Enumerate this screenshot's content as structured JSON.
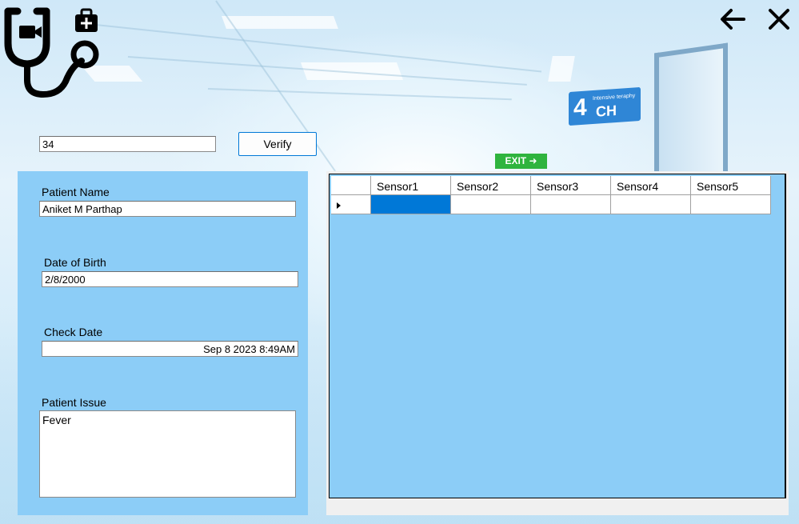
{
  "header": {
    "logo_icon": "stethoscope-medical-kit-icon",
    "back_icon": "arrow-left-icon",
    "close_icon": "close-icon"
  },
  "background": {
    "sign_number": "4",
    "sign_small_text": "Intensive teraphy",
    "sign_code": "CH",
    "exit_text": "EXIT ➜"
  },
  "search": {
    "patient_id_value": "34",
    "verify_label": "Verify"
  },
  "patient": {
    "name_label": "Patient Name",
    "name_value": "Aniket M Parthap",
    "dob_label": "Date of Birth",
    "dob_value": "2/8/2000",
    "check_date_label": "Check Date",
    "check_date_value": "Sep  8 2023  8:49AM",
    "issue_label": "Patient Issue",
    "issue_value": "Fever"
  },
  "grid": {
    "columns": [
      "Sensor1",
      "Sensor2",
      "Sensor3",
      "Sensor4",
      "Sensor5"
    ],
    "rows": [
      [
        "",
        "",
        "",
        "",
        ""
      ]
    ],
    "selected_cell": "Sensor1"
  },
  "colors": {
    "panel": "#8ccdf7",
    "selection": "#0078d7",
    "verify_border": "#0078d7"
  }
}
